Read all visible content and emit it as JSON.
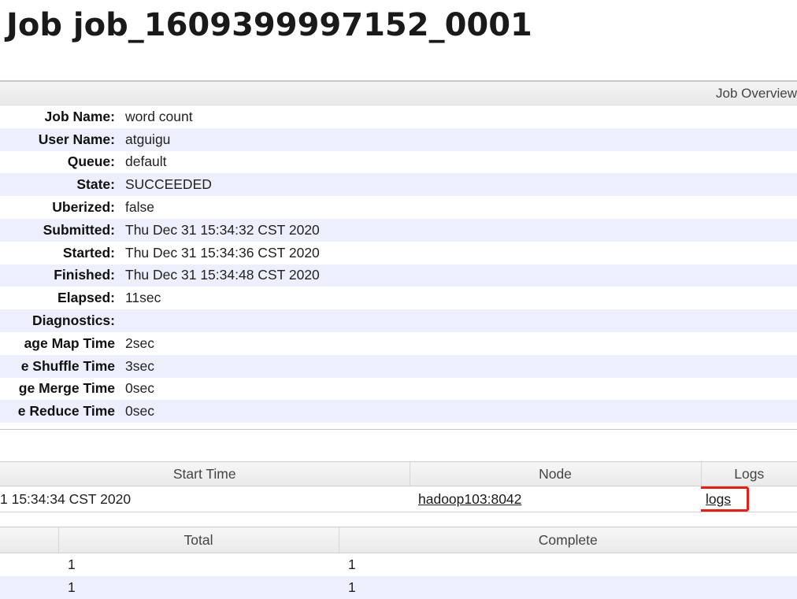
{
  "page": {
    "title": "Job job_1609399997152_0001"
  },
  "overview": {
    "header": "Job Overview",
    "rows": [
      {
        "key": "Job Name:",
        "value": "word count"
      },
      {
        "key": "User Name:",
        "value": "atguigu"
      },
      {
        "key": "Queue:",
        "value": "default"
      },
      {
        "key": "State:",
        "value": "SUCCEEDED"
      },
      {
        "key": "Uberized:",
        "value": "false"
      },
      {
        "key": "Submitted:",
        "value": "Thu Dec 31 15:34:32 CST 2020"
      },
      {
        "key": "Started:",
        "value": "Thu Dec 31 15:34:36 CST 2020"
      },
      {
        "key": "Finished:",
        "value": "Thu Dec 31 15:34:48 CST 2020"
      },
      {
        "key": "Elapsed:",
        "value": "11sec"
      },
      {
        "key": "Diagnostics:",
        "value": ""
      },
      {
        "key": "age Map Time",
        "value": "2sec"
      },
      {
        "key": "e Shuffle Time",
        "value": "3sec"
      },
      {
        "key": "ge Merge Time",
        "value": "0sec"
      },
      {
        "key": "e Reduce Time",
        "value": "0sec"
      }
    ]
  },
  "attempts": {
    "headers": {
      "start_time": "Start Time",
      "node": "Node",
      "logs": "Logs"
    },
    "row": {
      "start_time": "1 15:34:34 CST 2020",
      "node": "hadoop103:8042",
      "logs": "logs"
    },
    "highlight_color": "#e0201b"
  },
  "tasks": {
    "headers": {
      "total": "Total",
      "complete": "Complete"
    },
    "rows": [
      {
        "total": "1",
        "complete": "1"
      },
      {
        "total": "1",
        "complete": "1"
      }
    ]
  }
}
